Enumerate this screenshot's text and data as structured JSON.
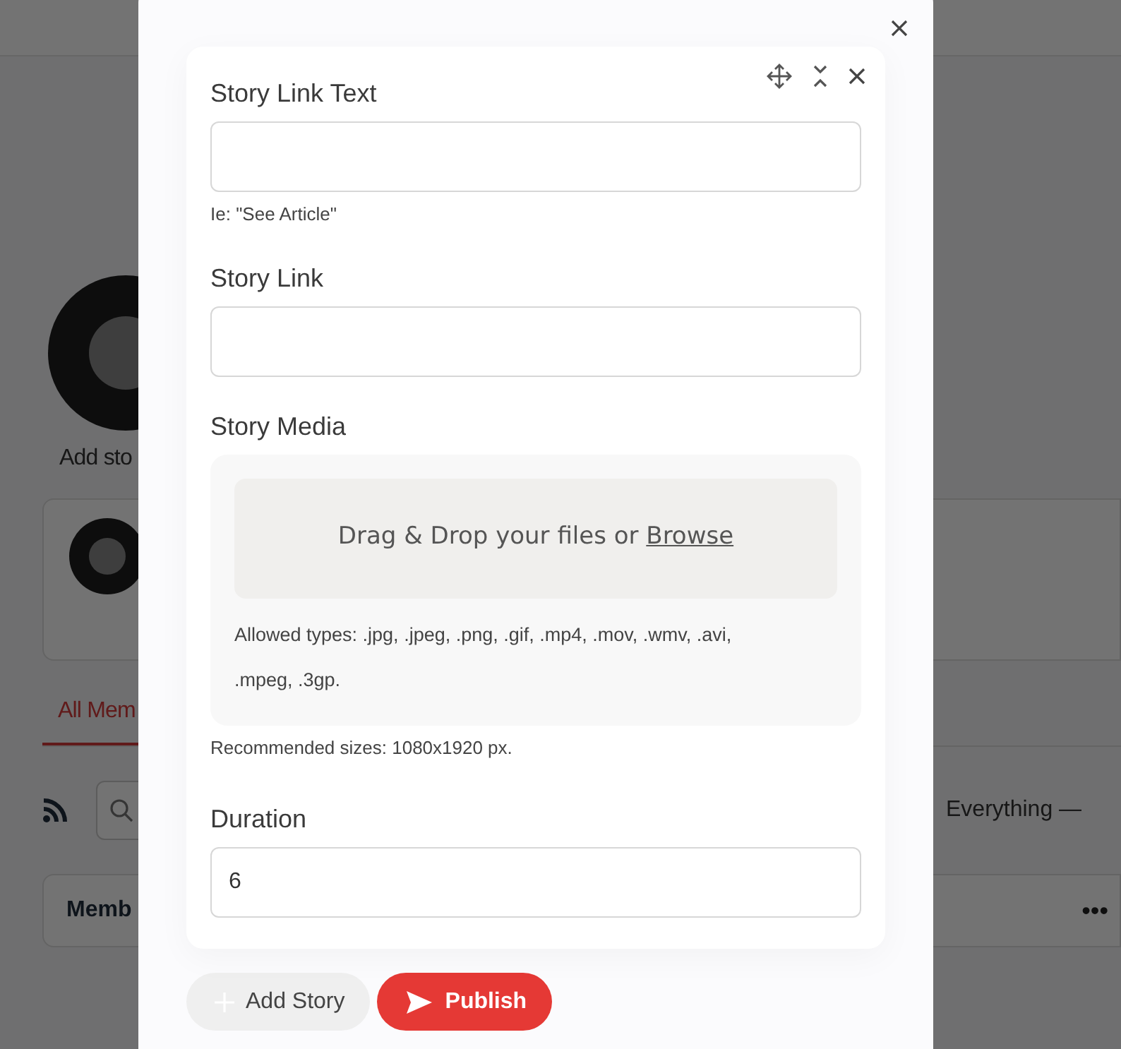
{
  "background": {
    "story_label": "Add sto",
    "tab": {
      "label": "All Mem",
      "selected": true
    },
    "filter": "Everything —",
    "table_header": "Memb",
    "more": "•••"
  },
  "story_form": {
    "fields": [
      {
        "kind": "text",
        "label": "Story Link Text",
        "hint": "Ie: \"See Article\""
      },
      {
        "kind": "text",
        "label": "Story Link"
      },
      {
        "kind": "media",
        "label": "Story Media",
        "drop_text": "Drag & Drop your files or",
        "browse_link": "Browse",
        "allowed": "Allowed types: .jpg, .jpeg, .png, .gif, .mp4, .mov, .wmv, .avi, .mpeg, .3gp.",
        "hint": "Recommended sizes: 1080x1920 px."
      },
      {
        "kind": "text",
        "label": "Duration",
        "value": "6"
      }
    ]
  },
  "buttons": [
    {
      "kind": "secondary",
      "label": "Add Story"
    },
    {
      "kind": "primary",
      "label": "Publish"
    }
  ]
}
